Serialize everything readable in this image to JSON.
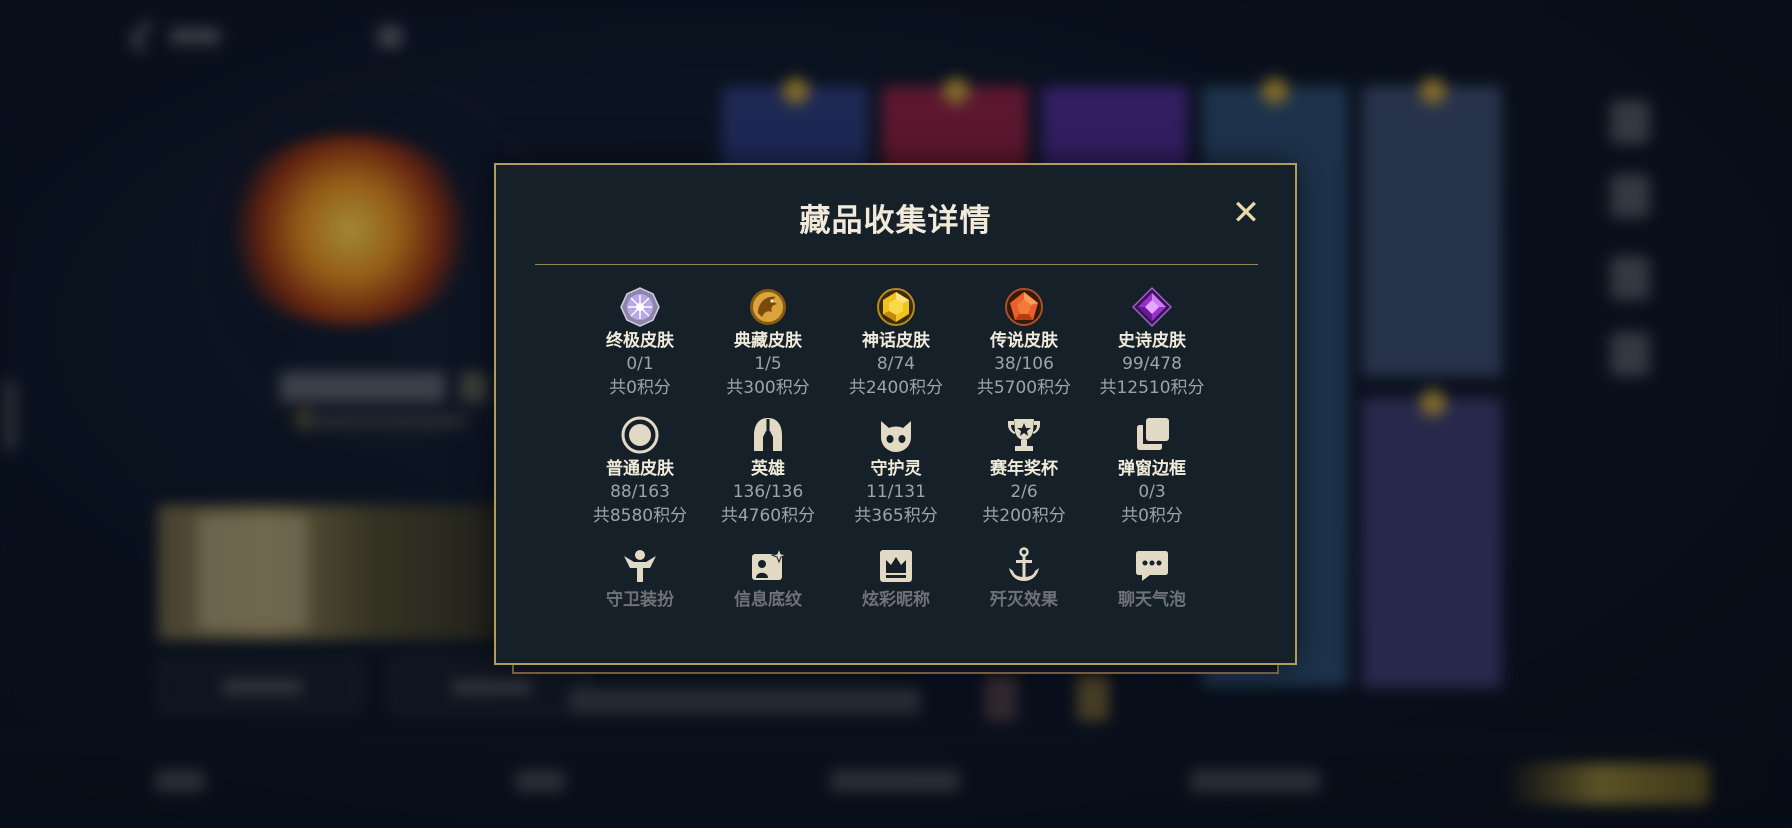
{
  "modal": {
    "title": "藏品收集详情",
    "close_symbol": "✕"
  },
  "categories": [
    {
      "label": "终极皮肤",
      "count": "0/1",
      "points": "共0积分",
      "icon": "ultimate-skin-gem-icon",
      "color": "#c9b6f2"
    },
    {
      "label": "典藏皮肤",
      "count": "1/5",
      "points": "共300积分",
      "icon": "collector-dragon-icon",
      "color": "#d7a63a"
    },
    {
      "label": "神话皮肤",
      "count": "8/74",
      "points": "共2400积分",
      "icon": "mythic-gem-icon",
      "color": "#e9b51a"
    },
    {
      "label": "传说皮肤",
      "count": "38/106",
      "points": "共5700积分",
      "icon": "legendary-gem-icon",
      "color": "#e8622a"
    },
    {
      "label": "史诗皮肤",
      "count": "99/478",
      "points": "共12510积分",
      "icon": "epic-gem-icon",
      "color": "#a030d0"
    },
    {
      "label": "普通皮肤",
      "count": "88/163",
      "points": "共8580积分",
      "icon": "normal-skin-circle-icon",
      "color": "#e3dac6"
    },
    {
      "label": "英雄",
      "count": "136/136",
      "points": "共4760积分",
      "icon": "hero-helmet-icon",
      "color": "#e3dac6"
    },
    {
      "label": "守护灵",
      "count": "11/131",
      "points": "共365积分",
      "icon": "guardian-spirit-icon",
      "color": "#e3dac6"
    },
    {
      "label": "赛年奖杯",
      "count": "2/6",
      "points": "共200积分",
      "icon": "trophy-icon",
      "color": "#e3dac6"
    },
    {
      "label": "弹窗边框",
      "count": "0/3",
      "points": "共0积分",
      "icon": "popup-frame-icon",
      "color": "#e3dac6"
    },
    {
      "label": "守卫装扮",
      "icon": "ward-skin-icon",
      "color": "#e3dac6"
    },
    {
      "label": "信息底纹",
      "icon": "info-background-icon",
      "color": "#e3dac6"
    },
    {
      "label": "炫彩昵称",
      "icon": "colorful-nickname-icon",
      "color": "#e3dac6"
    },
    {
      "label": "歼灭效果",
      "icon": "kill-effect-anchor-icon",
      "color": "#e3dac6"
    },
    {
      "label": "聊天气泡",
      "icon": "chat-bubble-icon",
      "color": "#e3dac6"
    }
  ]
}
